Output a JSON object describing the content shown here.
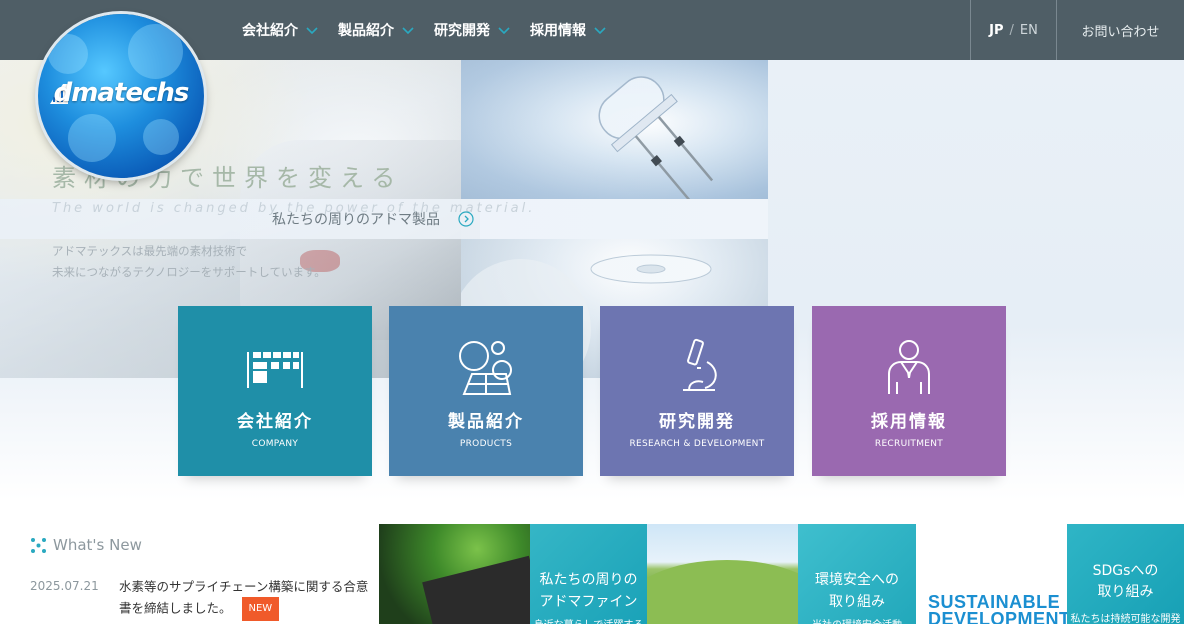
{
  "header": {
    "nav": [
      {
        "label": "会社紹介"
      },
      {
        "label": "製品紹介"
      },
      {
        "label": "研究開発"
      },
      {
        "label": "採用情報"
      }
    ],
    "lang_jp": "JP",
    "lang_sep": "/",
    "lang_en": "EN",
    "contact": "お問い合わせ"
  },
  "logo": {
    "text": "dmatechs"
  },
  "hero": {
    "tagline_jp": "素材の力で世界を変える",
    "tagline_en": "The world is changed by the power of the material.",
    "products_link": "私たちの周りのアドマ製品",
    "desc_line1": "アドマテックスは最先端の素材技術で",
    "desc_line2": "未来につながるテクノロジーをサポートしています。"
  },
  "cards": [
    {
      "jp": "会社紹介",
      "en": "COMPANY",
      "icon": "building-icon",
      "color": "#1f8fa8"
    },
    {
      "jp": "製品紹介",
      "en": "PRODUCTS",
      "icon": "particles-icon",
      "color": "#4a82ae"
    },
    {
      "jp": "研究開発",
      "en": "RESEARCH & DEVELOPMENT",
      "icon": "microscope-icon",
      "color": "#6d75b1"
    },
    {
      "jp": "採用情報",
      "en": "RECRUITMENT",
      "icon": "person-icon",
      "color": "#9a69b0"
    }
  ],
  "news": {
    "title": "What's New",
    "items": [
      {
        "date": "2025.07.21",
        "text": "水素等のサプライチェーン構築に関する合意書を締結しました。",
        "badge": "NEW"
      }
    ]
  },
  "tiles": {
    "adma_fine_line1": "私たちの周りの",
    "adma_fine_line2": "アドマファイン",
    "adma_fine_sub": "身近な暮らしで活躍する",
    "env_line1": "環境安全への",
    "env_line2": "取り組み",
    "env_sub": "当社の環境安全活動",
    "sustainable_line1": "SUSTAINABLE",
    "sustainable_line2": "DEVELOPMENT",
    "sdgs_line1": "SDGsへの",
    "sdgs_line2": "取り組み",
    "sdgs_sub": "私たちは持続可能な開発"
  },
  "colors": {
    "header_bg": "#4f5e66",
    "accent": "#2aa9c0",
    "new_badge": "#f05a2a"
  }
}
